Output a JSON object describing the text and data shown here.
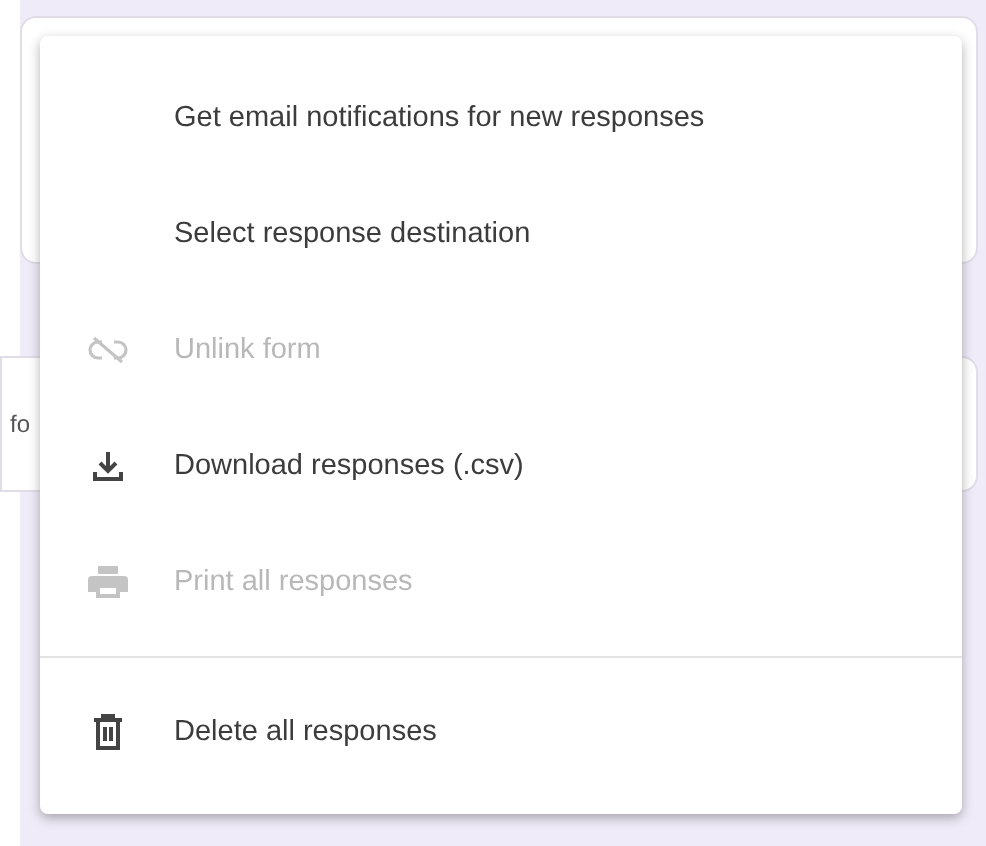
{
  "background": {
    "card_text": "fo"
  },
  "menu": {
    "groups": [
      {
        "items": [
          {
            "kind": "plain",
            "label": "Get email notifications for new responses",
            "disabled": false
          },
          {
            "kind": "plain",
            "label": "Select response destination",
            "disabled": false
          },
          {
            "kind": "unlink",
            "label": "Unlink form",
            "disabled": true
          },
          {
            "kind": "download",
            "label": "Download responses (.csv)",
            "disabled": false
          },
          {
            "kind": "print",
            "label": "Print all responses",
            "disabled": true
          }
        ]
      },
      {
        "items": [
          {
            "kind": "delete",
            "label": "Delete all responses",
            "disabled": false
          }
        ]
      }
    ]
  }
}
